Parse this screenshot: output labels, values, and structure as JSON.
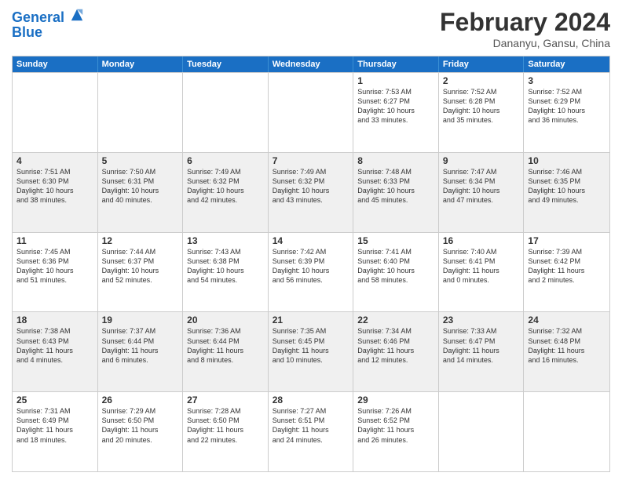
{
  "header": {
    "logo_line1": "General",
    "logo_line2": "Blue",
    "month_title": "February 2024",
    "location": "Dananyu, Gansu, China"
  },
  "days_of_week": [
    "Sunday",
    "Monday",
    "Tuesday",
    "Wednesday",
    "Thursday",
    "Friday",
    "Saturday"
  ],
  "weeks": [
    [
      {
        "day": "",
        "info": ""
      },
      {
        "day": "",
        "info": ""
      },
      {
        "day": "",
        "info": ""
      },
      {
        "day": "",
        "info": ""
      },
      {
        "day": "1",
        "info": "Sunrise: 7:53 AM\nSunset: 6:27 PM\nDaylight: 10 hours\nand 33 minutes."
      },
      {
        "day": "2",
        "info": "Sunrise: 7:52 AM\nSunset: 6:28 PM\nDaylight: 10 hours\nand 35 minutes."
      },
      {
        "day": "3",
        "info": "Sunrise: 7:52 AM\nSunset: 6:29 PM\nDaylight: 10 hours\nand 36 minutes."
      }
    ],
    [
      {
        "day": "4",
        "info": "Sunrise: 7:51 AM\nSunset: 6:30 PM\nDaylight: 10 hours\nand 38 minutes."
      },
      {
        "day": "5",
        "info": "Sunrise: 7:50 AM\nSunset: 6:31 PM\nDaylight: 10 hours\nand 40 minutes."
      },
      {
        "day": "6",
        "info": "Sunrise: 7:49 AM\nSunset: 6:32 PM\nDaylight: 10 hours\nand 42 minutes."
      },
      {
        "day": "7",
        "info": "Sunrise: 7:49 AM\nSunset: 6:32 PM\nDaylight: 10 hours\nand 43 minutes."
      },
      {
        "day": "8",
        "info": "Sunrise: 7:48 AM\nSunset: 6:33 PM\nDaylight: 10 hours\nand 45 minutes."
      },
      {
        "day": "9",
        "info": "Sunrise: 7:47 AM\nSunset: 6:34 PM\nDaylight: 10 hours\nand 47 minutes."
      },
      {
        "day": "10",
        "info": "Sunrise: 7:46 AM\nSunset: 6:35 PM\nDaylight: 10 hours\nand 49 minutes."
      }
    ],
    [
      {
        "day": "11",
        "info": "Sunrise: 7:45 AM\nSunset: 6:36 PM\nDaylight: 10 hours\nand 51 minutes."
      },
      {
        "day": "12",
        "info": "Sunrise: 7:44 AM\nSunset: 6:37 PM\nDaylight: 10 hours\nand 52 minutes."
      },
      {
        "day": "13",
        "info": "Sunrise: 7:43 AM\nSunset: 6:38 PM\nDaylight: 10 hours\nand 54 minutes."
      },
      {
        "day": "14",
        "info": "Sunrise: 7:42 AM\nSunset: 6:39 PM\nDaylight: 10 hours\nand 56 minutes."
      },
      {
        "day": "15",
        "info": "Sunrise: 7:41 AM\nSunset: 6:40 PM\nDaylight: 10 hours\nand 58 minutes."
      },
      {
        "day": "16",
        "info": "Sunrise: 7:40 AM\nSunset: 6:41 PM\nDaylight: 11 hours\nand 0 minutes."
      },
      {
        "day": "17",
        "info": "Sunrise: 7:39 AM\nSunset: 6:42 PM\nDaylight: 11 hours\nand 2 minutes."
      }
    ],
    [
      {
        "day": "18",
        "info": "Sunrise: 7:38 AM\nSunset: 6:43 PM\nDaylight: 11 hours\nand 4 minutes."
      },
      {
        "day": "19",
        "info": "Sunrise: 7:37 AM\nSunset: 6:44 PM\nDaylight: 11 hours\nand 6 minutes."
      },
      {
        "day": "20",
        "info": "Sunrise: 7:36 AM\nSunset: 6:44 PM\nDaylight: 11 hours\nand 8 minutes."
      },
      {
        "day": "21",
        "info": "Sunrise: 7:35 AM\nSunset: 6:45 PM\nDaylight: 11 hours\nand 10 minutes."
      },
      {
        "day": "22",
        "info": "Sunrise: 7:34 AM\nSunset: 6:46 PM\nDaylight: 11 hours\nand 12 minutes."
      },
      {
        "day": "23",
        "info": "Sunrise: 7:33 AM\nSunset: 6:47 PM\nDaylight: 11 hours\nand 14 minutes."
      },
      {
        "day": "24",
        "info": "Sunrise: 7:32 AM\nSunset: 6:48 PM\nDaylight: 11 hours\nand 16 minutes."
      }
    ],
    [
      {
        "day": "25",
        "info": "Sunrise: 7:31 AM\nSunset: 6:49 PM\nDaylight: 11 hours\nand 18 minutes."
      },
      {
        "day": "26",
        "info": "Sunrise: 7:29 AM\nSunset: 6:50 PM\nDaylight: 11 hours\nand 20 minutes."
      },
      {
        "day": "27",
        "info": "Sunrise: 7:28 AM\nSunset: 6:50 PM\nDaylight: 11 hours\nand 22 minutes."
      },
      {
        "day": "28",
        "info": "Sunrise: 7:27 AM\nSunset: 6:51 PM\nDaylight: 11 hours\nand 24 minutes."
      },
      {
        "day": "29",
        "info": "Sunrise: 7:26 AM\nSunset: 6:52 PM\nDaylight: 11 hours\nand 26 minutes."
      },
      {
        "day": "",
        "info": ""
      },
      {
        "day": "",
        "info": ""
      }
    ]
  ]
}
